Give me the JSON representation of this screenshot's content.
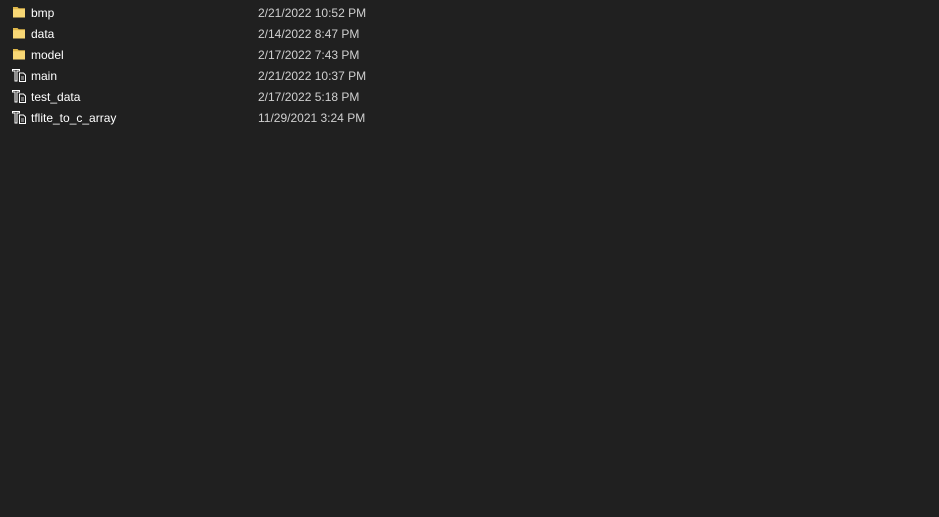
{
  "files": [
    {
      "name": "bmp",
      "modified": "2/21/2022 10:52 PM",
      "icon": "folder-icon"
    },
    {
      "name": "data",
      "modified": "2/14/2022 8:47 PM",
      "icon": "folder-icon"
    },
    {
      "name": "model",
      "modified": "2/17/2022 7:43 PM",
      "icon": "folder-icon"
    },
    {
      "name": "main",
      "modified": "2/21/2022 10:37 PM",
      "icon": "python-file-icon"
    },
    {
      "name": "test_data",
      "modified": "2/17/2022 5:18 PM",
      "icon": "python-file-icon"
    },
    {
      "name": "tflite_to_c_array",
      "modified": "11/29/2021 3:24 PM",
      "icon": "python-file-icon"
    }
  ],
  "colors": {
    "background": "#202020",
    "folder": "#f8d775",
    "folder_tab": "#e0b84a"
  }
}
